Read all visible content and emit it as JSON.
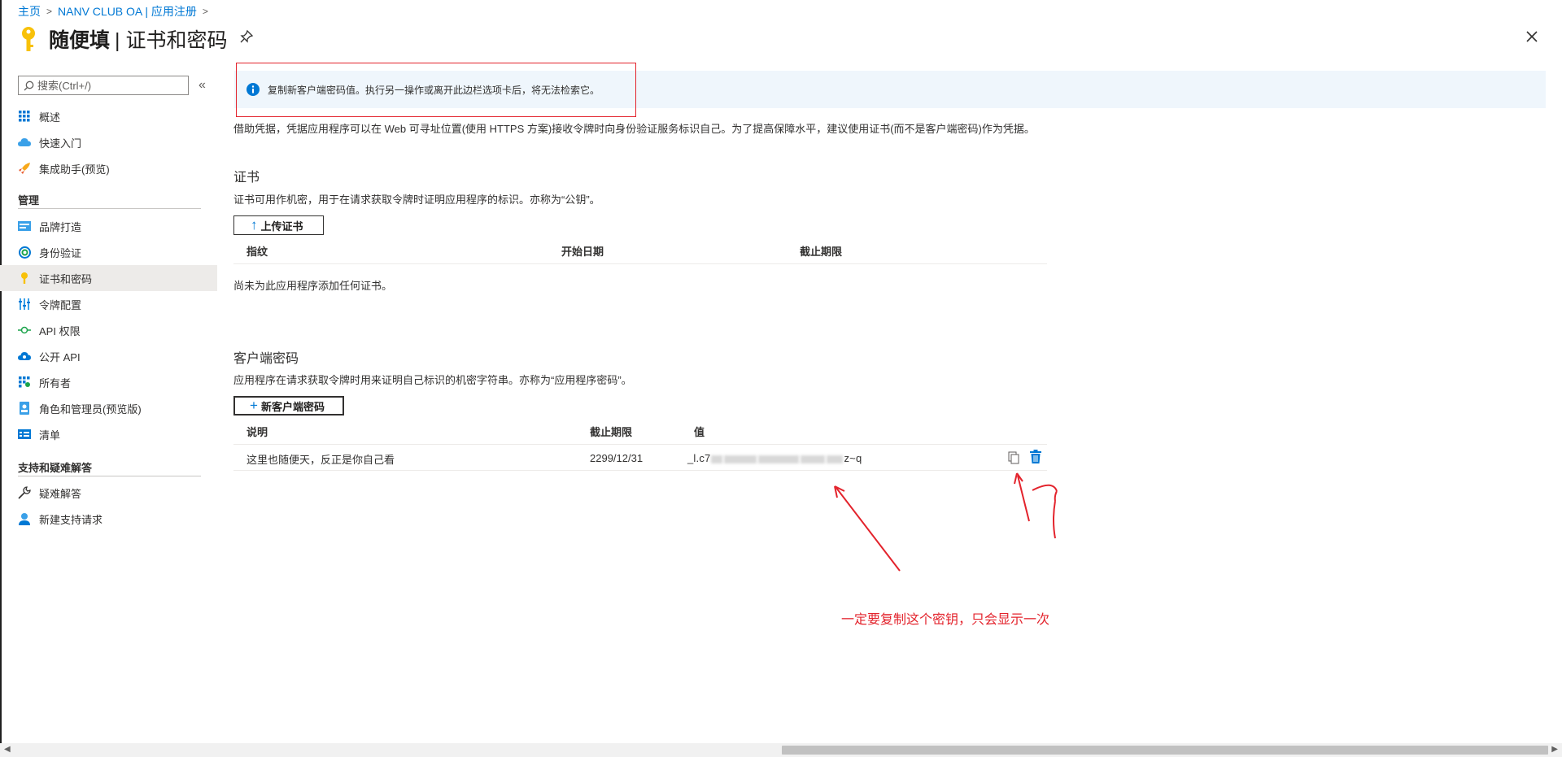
{
  "breadcrumb": [
    {
      "label": "主页"
    },
    {
      "label": "NANV CLUB OA | 应用注册"
    }
  ],
  "header": {
    "app_name": "随便填",
    "page_title": "| 证书和密码"
  },
  "sidebar": {
    "search_placeholder": "搜索(Ctrl+/)",
    "collapse_glyph": "«",
    "items_top": [
      {
        "label": "概述",
        "icon": "overview-icon"
      },
      {
        "label": "快速入门",
        "icon": "quickstart-icon"
      },
      {
        "label": "集成助手(预览)",
        "icon": "rocket-icon"
      }
    ],
    "section_manage": "管理",
    "items_manage": [
      {
        "label": "品牌打造",
        "icon": "branding-icon"
      },
      {
        "label": "身份验证",
        "icon": "authentication-icon"
      },
      {
        "label": "证书和密码",
        "icon": "key-icon",
        "active": true
      },
      {
        "label": "令牌配置",
        "icon": "token-config-icon"
      },
      {
        "label": "API 权限",
        "icon": "api-permissions-icon"
      },
      {
        "label": "公开 API",
        "icon": "expose-api-icon"
      },
      {
        "label": "所有者",
        "icon": "owners-icon"
      },
      {
        "label": "角色和管理员(预览版)",
        "icon": "roles-icon"
      },
      {
        "label": "清单",
        "icon": "manifest-icon"
      }
    ],
    "section_support": "支持和疑难解答",
    "items_support": [
      {
        "label": "疑难解答",
        "icon": "troubleshoot-icon"
      },
      {
        "label": "新建支持请求",
        "icon": "support-request-icon"
      }
    ]
  },
  "banner": {
    "text": "复制新客户端密码值。执行另一操作或离开此边栏选项卡后，将无法检索它。"
  },
  "intro": "借助凭据，凭据应用程序可以在 Web 可寻址位置(使用 HTTPS 方案)接收令牌时向身份验证服务标识自己。为了提高保障水平，建议使用证书(而不是客户端密码)作为凭据。",
  "certificates": {
    "title": "证书",
    "description": "证书可用作机密，用于在请求获取令牌时证明应用程序的标识。亦称为“公钥”。",
    "upload_label": "上传证书",
    "columns": [
      "指纹",
      "开始日期",
      "截止期限"
    ],
    "empty_message": "尚未为此应用程序添加任何证书。"
  },
  "client_secrets": {
    "title": "客户端密码",
    "description": "应用程序在请求获取令牌时用来证明自己标识的机密字符串。亦称为“应用程序密码”。",
    "new_label": "新客户端密码",
    "columns": [
      "说明",
      "截止期限",
      "值"
    ],
    "rows": [
      {
        "description": "这里也随便天，反正是你自己看",
        "expires": "2299/12/31",
        "value_prefix": "_l.c7",
        "value_suffix": "z~q"
      }
    ]
  },
  "annotation": {
    "text": "一定要复制这个密钥，只会显示一次",
    "color": "#e3232c"
  },
  "colors": {
    "accent": "#0078d4",
    "banner_bg": "#eff6fc",
    "active_nav": "#edebe9"
  }
}
